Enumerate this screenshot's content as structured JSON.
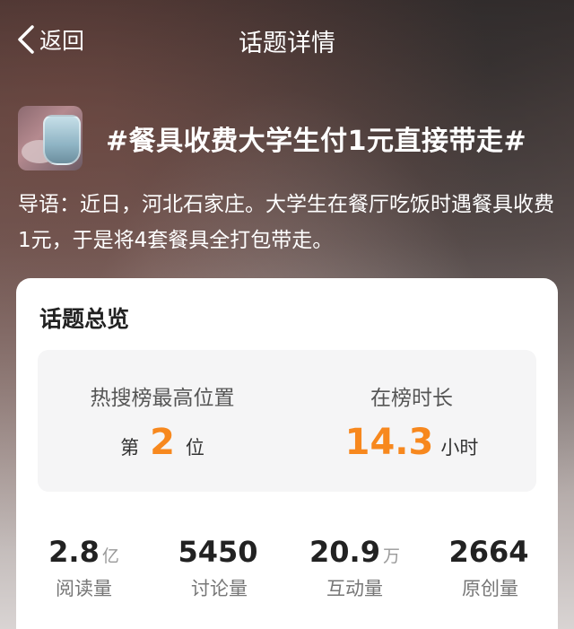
{
  "nav": {
    "back_label": "返回",
    "title": "话题详情",
    "icons": {
      "back": "chevron-left-icon"
    }
  },
  "topic": {
    "title": "#餐具收费大学生付1元直接带走#",
    "intro": "导语：近日，河北石家庄。大学生在餐厅吃饭时遇餐具收费1元，于是将4套餐具全打包带走。"
  },
  "overview": {
    "title": "话题总览",
    "highest_rank": {
      "label": "热搜榜最高位置",
      "prefix": "第",
      "value": "2",
      "suffix": "位"
    },
    "duration": {
      "label": "在榜时长",
      "value": "14.3",
      "unit": "小时"
    },
    "metrics": [
      {
        "value": "2.8",
        "unit": "亿",
        "label": "阅读量"
      },
      {
        "value": "5450",
        "unit": "",
        "label": "讨论量"
      },
      {
        "value": "20.9",
        "unit": "万",
        "label": "互动量"
      },
      {
        "value": "2664",
        "unit": "",
        "label": "原创量"
      }
    ]
  },
  "colors": {
    "accent": "#f7881e",
    "text_primary": "#222222",
    "text_secondary": "#777777",
    "panel_bg": "#f5f5f6"
  }
}
